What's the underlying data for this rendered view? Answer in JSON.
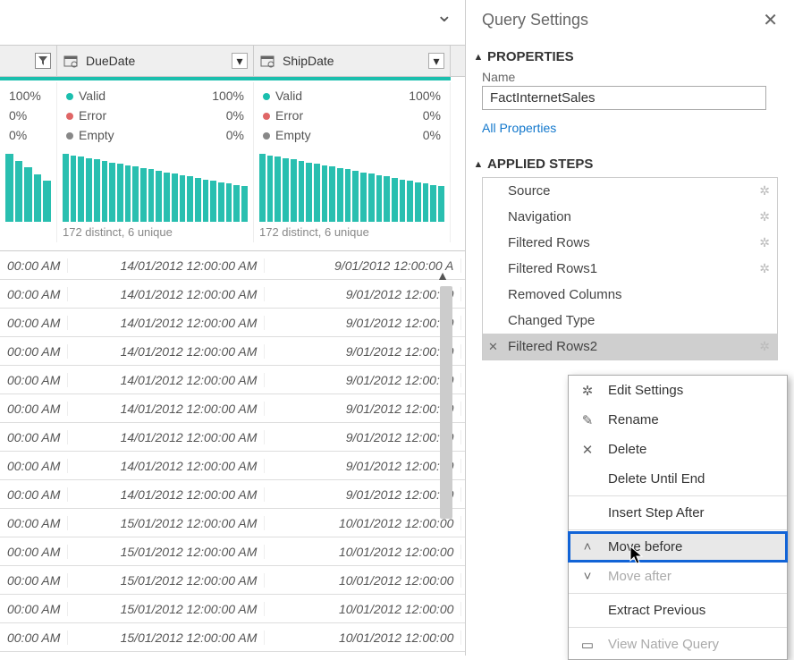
{
  "header": {
    "title": "Query Settings"
  },
  "properties": {
    "section": "PROPERTIES",
    "name_label": "Name",
    "name_value": "FactInternetSales",
    "all_props": "All Properties"
  },
  "applied": {
    "section": "APPLIED STEPS",
    "steps": [
      {
        "label": "Source",
        "gear": true
      },
      {
        "label": "Navigation",
        "gear": true
      },
      {
        "label": "Filtered Rows",
        "gear": true
      },
      {
        "label": "Filtered Rows1",
        "gear": true
      },
      {
        "label": "Removed Columns",
        "gear": false
      },
      {
        "label": "Changed Type",
        "gear": false
      },
      {
        "label": "Filtered Rows2",
        "gear": true
      }
    ]
  },
  "context_menu": {
    "items": [
      {
        "icon": "gear",
        "label": "Edit Settings"
      },
      {
        "icon": "rename",
        "label": "Rename"
      },
      {
        "icon": "x",
        "label": "Delete"
      },
      {
        "icon": "",
        "label": "Delete Until End"
      },
      {
        "sep": true
      },
      {
        "icon": "",
        "label": "Insert Step After"
      },
      {
        "sep": true
      },
      {
        "icon": "up",
        "label": "Move before"
      },
      {
        "icon": "down",
        "label": "Move after",
        "disabled": true
      },
      {
        "sep": true
      },
      {
        "icon": "",
        "label": "Extract Previous"
      },
      {
        "sep": true
      },
      {
        "icon": "doc",
        "label": "View Native Query",
        "disabled": true
      }
    ]
  },
  "columns": {
    "col0_partial": "00:00 AM",
    "col0_pct": {
      "v": "100%",
      "e": "0%",
      "m": "0%"
    },
    "col1": {
      "name": "DueDate",
      "valid": "Valid",
      "valid_pct": "100%",
      "error": "Error",
      "error_pct": "0%",
      "empty": "Empty",
      "empty_pct": "0%",
      "dist": "172 distinct, 6 unique"
    },
    "col2": {
      "name": "ShipDate",
      "valid": "Valid",
      "valid_pct": "100%",
      "error": "Error",
      "error_pct": "0%",
      "empty": "Empty",
      "empty_pct": "0%",
      "dist": "172 distinct, 6 unique"
    }
  },
  "rows": [
    {
      "c1": "14/01/2012 12:00:00 AM",
      "c2": "9/01/2012 12:00:00 A"
    },
    {
      "c1": "14/01/2012 12:00:00 AM",
      "c2": "9/01/2012 12:00:00"
    },
    {
      "c1": "14/01/2012 12:00:00 AM",
      "c2": "9/01/2012 12:00:00"
    },
    {
      "c1": "14/01/2012 12:00:00 AM",
      "c2": "9/01/2012 12:00:00"
    },
    {
      "c1": "14/01/2012 12:00:00 AM",
      "c2": "9/01/2012 12:00:00"
    },
    {
      "c1": "14/01/2012 12:00:00 AM",
      "c2": "9/01/2012 12:00:00"
    },
    {
      "c1": "14/01/2012 12:00:00 AM",
      "c2": "9/01/2012 12:00:00"
    },
    {
      "c1": "14/01/2012 12:00:00 AM",
      "c2": "9/01/2012 12:00:00"
    },
    {
      "c1": "14/01/2012 12:00:00 AM",
      "c2": "9/01/2012 12:00:00"
    },
    {
      "c1": "15/01/2012 12:00:00 AM",
      "c2": "10/01/2012 12:00:00"
    },
    {
      "c1": "15/01/2012 12:00:00 AM",
      "c2": "10/01/2012 12:00:00"
    },
    {
      "c1": "15/01/2012 12:00:00 AM",
      "c2": "10/01/2012 12:00:00"
    },
    {
      "c1": "15/01/2012 12:00:00 AM",
      "c2": "10/01/2012 12:00:00"
    },
    {
      "c1": "15/01/2012 12:00:00 AM",
      "c2": "10/01/2012 12:00:00"
    }
  ]
}
